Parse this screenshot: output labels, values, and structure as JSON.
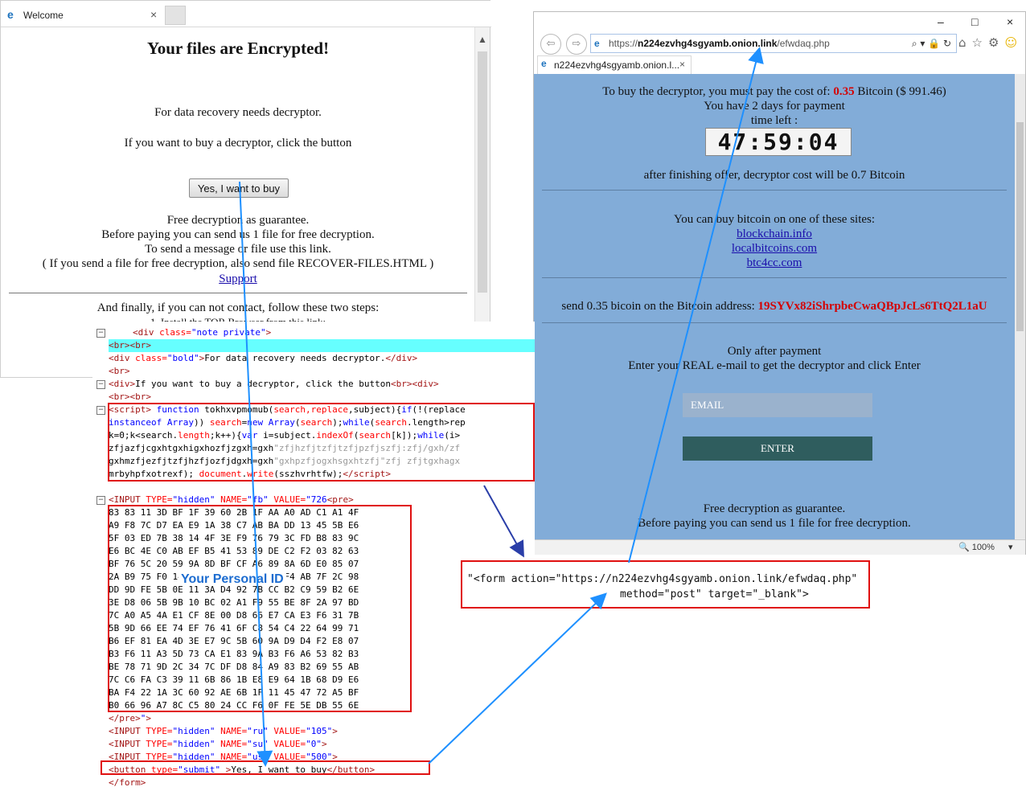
{
  "left_window": {
    "tab_title": "Welcome",
    "tab_close": "×",
    "heading": "Your files are Encrypted!",
    "line1": "For data recovery needs decryptor.",
    "line2": "If you want to buy a decryptor, click the button",
    "buy_button": "Yes, I want to buy",
    "guarantee": [
      "Free decryption as guarantee.",
      "Before paying you can send us 1 file for free decryption.",
      "To send a message or file use this link.",
      "( If you send a file for free decryption, also send file RECOVER-FILES.HTML )"
    ],
    "support_link": "Support",
    "finally": "And finally, if you can not contact, follow these two steps:",
    "partial_line": "1. Install the TOR Browser from this link:"
  },
  "right_window": {
    "controls": [
      "–",
      "□",
      "×"
    ],
    "url_prefix": "https://",
    "url_host": "n224ezvhg4sgyamb.onion.link",
    "url_path": "/efwdaq.php",
    "url_tools": "⌕ ▾ 🔒 ↻",
    "tab_title": "n224ezvhg4sgyamb.onion.l...",
    "tab_close": "×",
    "price_pre": "To buy the decryptor, you must pay the cost of: ",
    "price_btc": "0.35",
    "price_post": " Bitcoin ($ 991.46)",
    "days": "You have 2 days for payment",
    "time_left": "time left :",
    "timer": "47:59:04",
    "after_offer": "after finishing offer, decryptor cost will be 0.7 Bitcoin",
    "buy_sites_label": "You can buy bitcoin on one of these sites:",
    "sites": [
      "blockchain.info",
      "localbitcoins.com",
      "btc4cc.com"
    ],
    "send_label": "send 0.35 bicoin on the Bitcoin address: ",
    "address": "19SYVx82iShrpbeCwaQBpJcLs6TtQ2L1aU",
    "only_after": "Only after payment",
    "enter_email": "Enter your REAL e-mail to get the decryptor and click Enter",
    "email_placeholder": "EMAIL",
    "enter_button": "ENTER",
    "free_decrypt": "Free decryption as guarantee.",
    "before_paying": "Before paying you can send us 1 file for free decryption.",
    "zoom": "🔍 100%",
    "zoom_arrow": "▾"
  },
  "code": {
    "personal_id_label": "Your Personal ID",
    "hex_rows": [
      "83 83 11 3D BF 1F 39 60 2B 1F AA A0 AD C1 A1 4F",
      "A9 F8 7C D7 EA E9 1A 38 C7 AB BA DD 13 45 5B E6",
      "5F 03 ED 7B 38 14 4F 3E F9 76 79 3C FD B8 83 9C",
      "E6 BC 4E C0 AB EF B5 41 53 89 DE C2 F2 03 82 63",
      "BF 76 5C 20 59 9A 8D BF CF A6 89 8A 6D E0 85 07",
      "2A B9 75 F0 14 82 E9 3E 7C 1B E0 F4 AB 7F 2C 98",
      "DD 9D FE 5B 0E 11 3A D4 92 7B CC B2 C9 59 B2 6E",
      "3E D8 06 5B 9B 10 BC 02 A1 F9 55 BE 8F 2A 97 BD",
      "7C A0 A5 4A E1 CF 8E 00 D8 66 E7 CA E3 F6 31 7B",
      "5B 9D 66 EE 74 EF 76 41 6F C8 54 C4 22 64 99 71",
      "B6 EF 81 EA 4D 3E E7 9C 5B 60 9A D9 D4 F2 E8 07",
      "B3 F6 11 A3 5D 73 CA E1 83 9A B3 F6 A6 53 82 B3",
      "BE 78 71 9D 2C 34 7C DF D8 84 A9 83 B2 69 55 AB",
      "7C C6 FA C3 39 11 6B 86 1B E8 E9 64 1B 68 D9 E6",
      "BA F4 22 1A 3C 60 92 AE 6B 1F 11 45 47 72 A5 BF",
      "B0 66 96 A7 8C C5 80 24 CC F6 0F FE 5E DB 55 6E"
    ]
  },
  "form_snippet": {
    "line1": "\"<form action=\"https://n224ezvhg4sgyamb.onion.link/efwdaq.php\"",
    "line2": "method=\"post\" target=\"_blank\">"
  },
  "colors": {
    "page_bg": "#82acd8",
    "alert_red": "#d40000",
    "enter_btn": "#2f5d5e",
    "arrow_blue": "#1e90ff",
    "box_red": "#e01010"
  }
}
